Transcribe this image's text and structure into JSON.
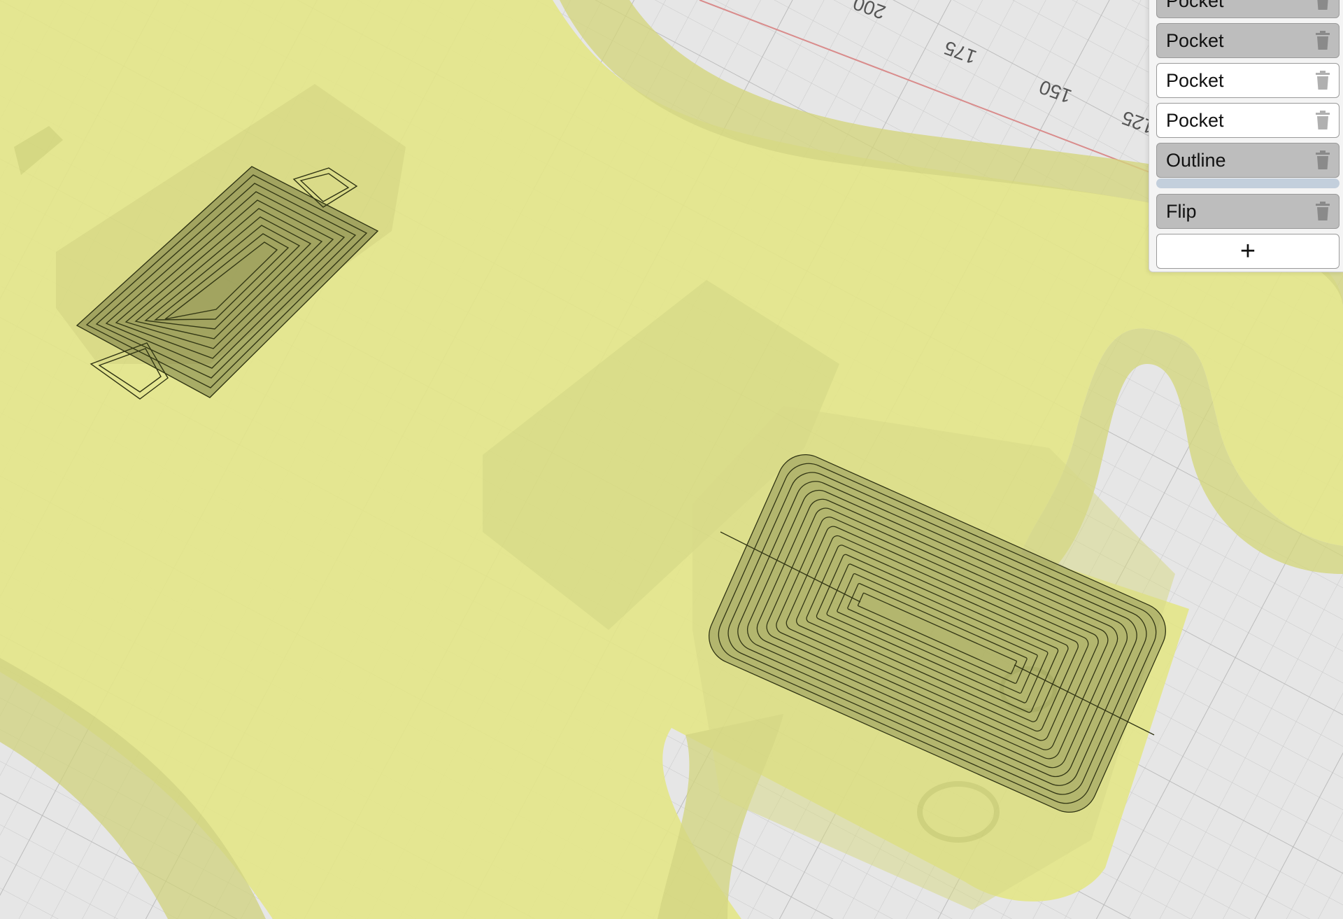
{
  "viewport": {
    "axis_labels": [
      "200",
      "175",
      "150",
      "125"
    ],
    "colors": {
      "grid_background": "#e6e6e6",
      "grid_line": "#c9c9c9",
      "part_fill": "#e4e68a",
      "toolpath": "#2f3313",
      "axis_line": "#d98c8c"
    }
  },
  "operations": {
    "items": [
      {
        "label": "Pocket",
        "state": "active"
      },
      {
        "label": "Pocket",
        "state": "active"
      },
      {
        "label": "Pocket",
        "state": "inactive"
      },
      {
        "label": "Pocket",
        "state": "inactive"
      },
      {
        "label": "Outline",
        "state": "active"
      },
      {
        "label": "Flip",
        "state": "active"
      }
    ],
    "delete_icon": "trash-icon",
    "add_label": "+"
  }
}
